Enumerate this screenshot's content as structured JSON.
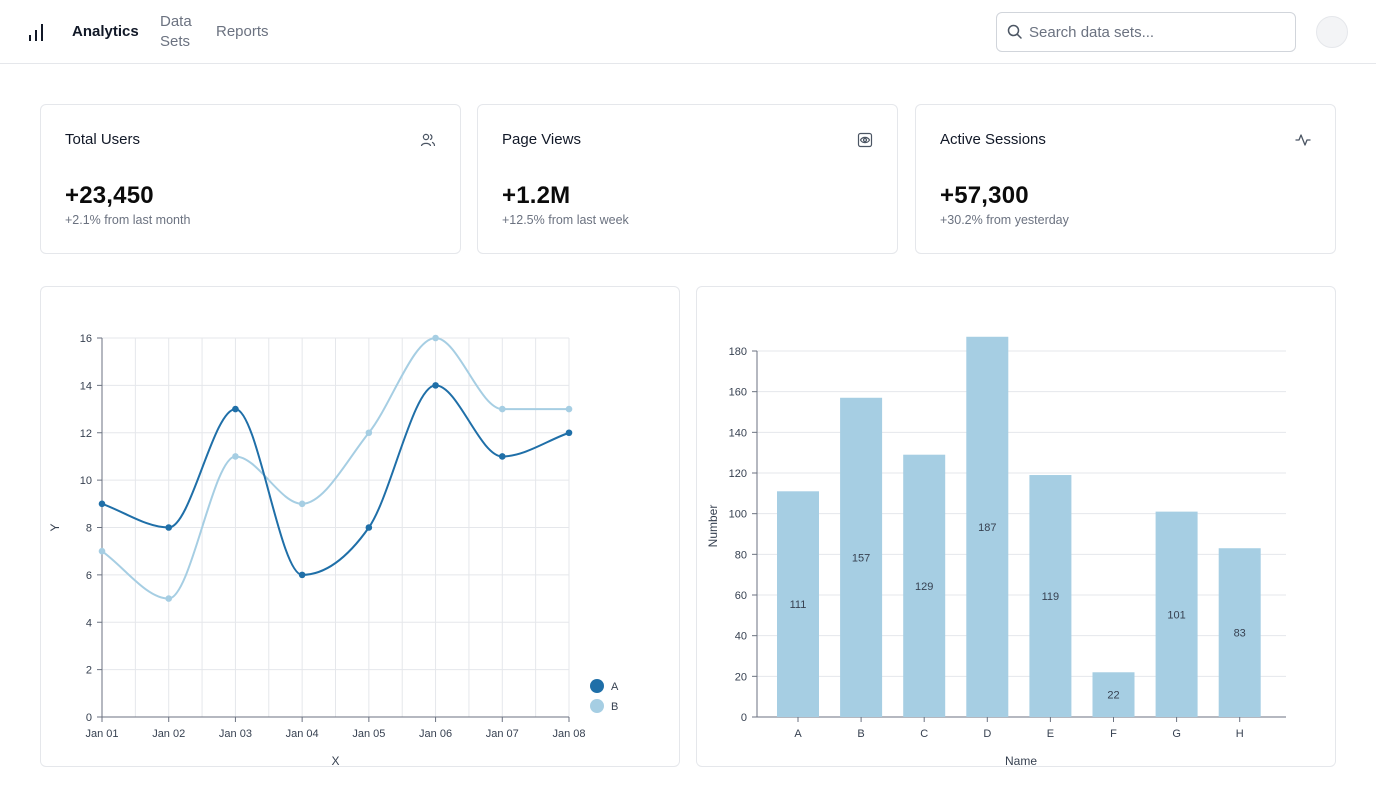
{
  "nav": {
    "items": [
      {
        "label": "Analytics",
        "active": true
      },
      {
        "label": "Data Sets",
        "active": false
      },
      {
        "label": "Reports",
        "active": false
      }
    ]
  },
  "search": {
    "placeholder": "Search data sets...",
    "value": ""
  },
  "cards": [
    {
      "title": "Total Users",
      "value": "+23,450",
      "subtitle": "+2.1% from last month",
      "icon": "users-icon"
    },
    {
      "title": "Page Views",
      "value": "+1.2M",
      "subtitle": "+12.5% from last week",
      "icon": "eye-icon"
    },
    {
      "title": "Active Sessions",
      "value": "+57,300",
      "subtitle": "+30.2% from yesterday",
      "icon": "activity-icon"
    }
  ],
  "colors": {
    "series_a": "#1f6fa8",
    "series_b": "#a6cee3",
    "bar": "#a6cee3",
    "grid": "#e5e7eb"
  },
  "chart_data": [
    {
      "type": "line",
      "xlabel": "X",
      "ylabel": "Y",
      "x": [
        "Jan 01",
        "Jan 02",
        "Jan 03",
        "Jan 04",
        "Jan 05",
        "Jan 06",
        "Jan 07",
        "Jan 08"
      ],
      "ylim": [
        0,
        16
      ],
      "yticks": [
        0,
        2,
        4,
        6,
        8,
        10,
        12,
        14,
        16
      ],
      "grid": true,
      "legend": "bottom-right",
      "series": [
        {
          "name": "A",
          "values": [
            9,
            8,
            13,
            6,
            8,
            14,
            11,
            12
          ]
        },
        {
          "name": "B",
          "values": [
            7,
            5,
            11,
            9,
            12,
            16,
            13,
            13
          ]
        }
      ]
    },
    {
      "type": "bar",
      "xlabel": "Name",
      "ylabel": "Number",
      "categories": [
        "A",
        "B",
        "C",
        "D",
        "E",
        "F",
        "G",
        "H"
      ],
      "values": [
        111,
        157,
        129,
        187,
        119,
        22,
        101,
        83
      ],
      "ylim": [
        0,
        180
      ],
      "yticks": [
        0,
        20,
        40,
        60,
        80,
        100,
        120,
        140,
        160,
        180
      ],
      "grid": true
    }
  ]
}
